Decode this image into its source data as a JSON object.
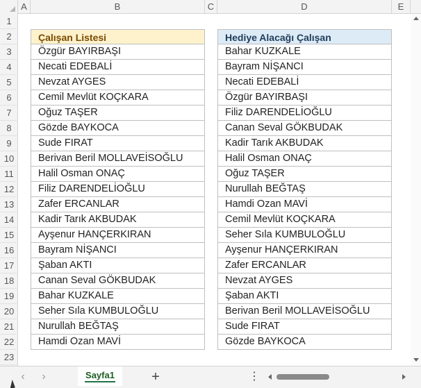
{
  "columns": [
    "A",
    "B",
    "C",
    "D",
    "E"
  ],
  "rows": [
    "1",
    "2",
    "3",
    "4",
    "5",
    "6",
    "7",
    "8",
    "9",
    "10",
    "11",
    "12",
    "13",
    "14",
    "15",
    "16",
    "17",
    "18",
    "19",
    "20",
    "21",
    "22",
    "23"
  ],
  "left_table": {
    "header": "Çalışan Listesi",
    "items": [
      "Özgür BAYIRBAŞI",
      "Necati EDEBALİ",
      "Nevzat AYGES",
      "Cemil Mevlüt KOÇKARA",
      "Oğuz TAŞER",
      "Gözde BAYKOCA",
      "Sude FIRAT",
      "Berivan Beril MOLLAVEİSOĞLU",
      "Halil Osman ONAÇ",
      "Filiz DARENDELİOĞLU",
      "Zafer ERCANLAR",
      "Kadir Tarık AKBUDAK",
      "Ayşenur HANÇERKIRAN",
      "Bayram NİŞANCI",
      "Şaban AKTI",
      "Canan Seval GÖKBUDAK",
      "Bahar KUZKALE",
      "Seher Sıla KUMBULOĞLU",
      "Nurullah BEĞTAŞ",
      "Hamdi Ozan MAVİ"
    ]
  },
  "right_table": {
    "header": "Hediye Alacağı Çalışan",
    "items": [
      "Bahar KUZKALE",
      "Bayram NİŞANCI",
      "Necati EDEBALİ",
      "Özgür BAYIRBAŞI",
      "Filiz DARENDELİOĞLU",
      "Canan Seval GÖKBUDAK",
      "Kadir Tarık AKBUDAK",
      "Halil Osman ONAÇ",
      "Oğuz TAŞER",
      "Nurullah BEĞTAŞ",
      "Hamdi Ozan MAVİ",
      "Cemil Mevlüt KOÇKARA",
      "Seher Sıla KUMBULOĞLU",
      "Ayşenur HANÇERKIRAN",
      "Zafer ERCANLAR",
      "Nevzat AYGES",
      "Şaban AKTI",
      "Berivan Beril MOLLAVEİSOĞLU",
      "Sude FIRAT",
      "Gözde BAYKOCA"
    ]
  },
  "tabbar": {
    "sheet_tab": "Sayfa1",
    "prev_glyph": "‹",
    "next_glyph": "›",
    "add_glyph": "+",
    "more_glyph": "⋮"
  },
  "colors": {
    "left_header_bg": "#fdf2cc",
    "right_header_bg": "#ddebf7",
    "sheet_tab_accent": "#217346"
  }
}
